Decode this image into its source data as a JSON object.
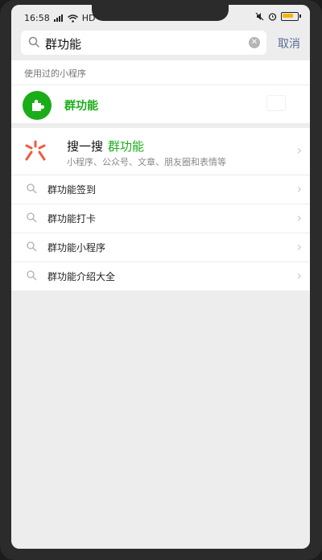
{
  "status_bar": {
    "time": "16:58",
    "network": "HD"
  },
  "search": {
    "query": "群功能",
    "cancel_label": "取消"
  },
  "used_section": {
    "title": "使用过的小程序",
    "item_name": "群功能"
  },
  "sousou": {
    "title": "搜一搜",
    "keyword": "群功能",
    "subtitle": "小程序、公众号、文章、朋友圈和表情等"
  },
  "suggestions": [
    "群功能签到",
    "群功能打卡",
    "群功能小程序",
    "群功能介绍大全"
  ],
  "colors": {
    "accent_green": "#1aad19",
    "link_blue": "#576b95",
    "background": "#ededed"
  }
}
